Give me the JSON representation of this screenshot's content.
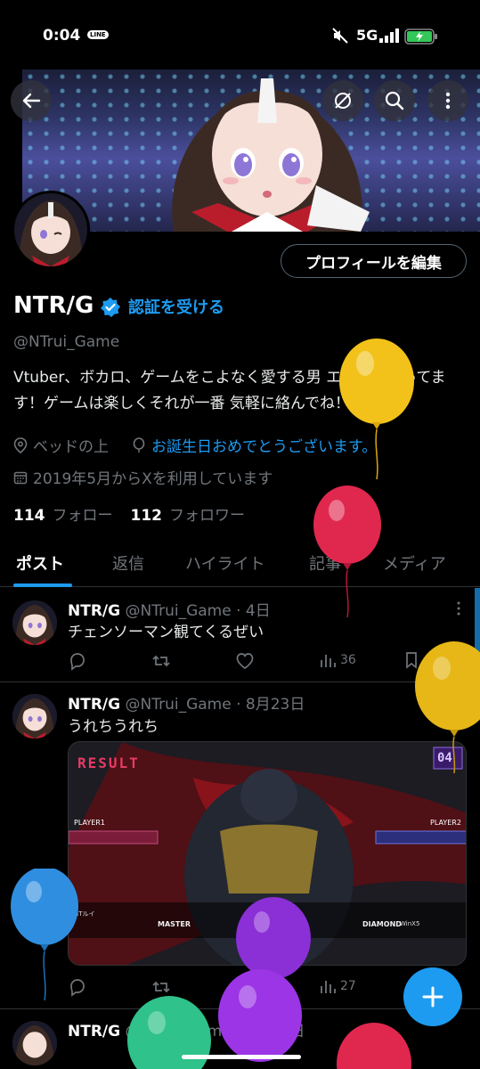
{
  "status_bar": {
    "time": "0:04",
    "line_badge": "LINE",
    "network": "5G"
  },
  "header": {
    "back_icon": "arrow-left-icon",
    "unfollow_icon": "slash-circle-icon",
    "search_icon": "search-icon",
    "more_icon": "more-vertical-icon"
  },
  "profile": {
    "edit_button": "プロフィールを編集",
    "display_name": "NTR/G",
    "get_verified": "認証を受ける",
    "handle": "@NTrui_Game",
    "bio": "Vtuber、ボカロ、ゲームをこよなく愛する男 エペよくやってます！ゲームは楽しくそれが一番 気軽に絡んでね！",
    "location": "ベッドの上",
    "birthday_message": "お誕生日おめでとうございます。",
    "joined": "2019年5月からXを利用しています",
    "following_count": "114",
    "following_label": "フォロー",
    "followers_count": "112",
    "followers_label": "フォロワー"
  },
  "tabs": [
    {
      "label": "ポスト",
      "active": true
    },
    {
      "label": "返信",
      "active": false
    },
    {
      "label": "ハイライト",
      "active": false
    },
    {
      "label": "記事",
      "active": false
    },
    {
      "label": "メディア",
      "active": false
    }
  ],
  "tweets": [
    {
      "name": "NTR/G",
      "meta": "@NTrui_Game · 4日",
      "text": "チェンソーマン観てくるぜい",
      "views": "36"
    },
    {
      "name": "NTR/G",
      "meta": "@NTrui_Game · 8月23日",
      "text": "うれちうれち",
      "views": "27",
      "media": {
        "result": "RESULT",
        "player1": "PLAYER1",
        "player2": "PLAYER2",
        "rank": "MASTER",
        "p1_name": "NTルイ",
        "round": "04",
        "p2_rank": "DIAMOND",
        "p2_extra": "WinX5"
      }
    },
    {
      "name": "NTR/G",
      "meta": "@NTrui_Game · 8月21日"
    }
  ],
  "fab": {
    "icon": "plus-icon"
  },
  "colors": {
    "accent": "#1d9bf0",
    "background": "#000000",
    "muted": "#71767b",
    "border": "#2f3336"
  }
}
